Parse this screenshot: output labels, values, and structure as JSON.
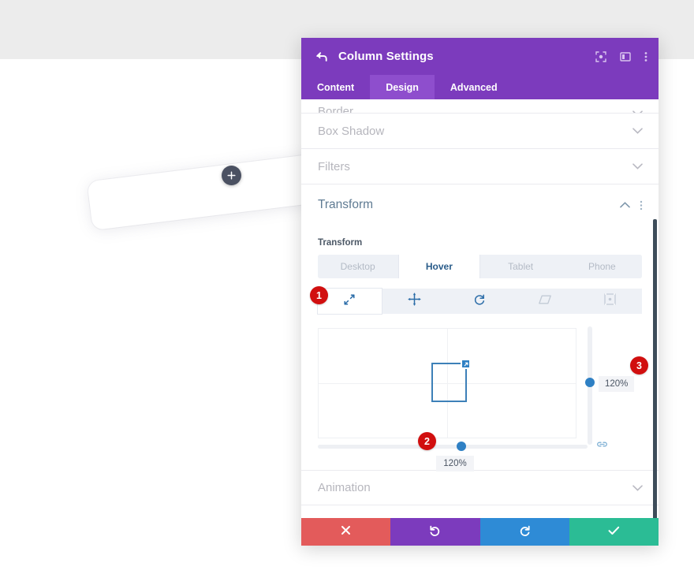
{
  "background": {
    "add_button_icon": "plus-icon",
    "row_label": ""
  },
  "modal": {
    "title": "Column Settings",
    "back_icon": "back-arrow-icon",
    "header_icons": [
      {
        "name": "focus-target-icon"
      },
      {
        "name": "layout-panel-icon"
      },
      {
        "name": "kebab-menu-icon"
      }
    ],
    "tabs": [
      {
        "label": "Content",
        "active": false
      },
      {
        "label": "Design",
        "active": true
      },
      {
        "label": "Advanced",
        "active": false
      }
    ],
    "sections": [
      {
        "label": "Border",
        "open": false,
        "clipped": true
      },
      {
        "label": "Box Shadow",
        "open": false,
        "clipped": false
      },
      {
        "label": "Filters",
        "open": false,
        "clipped": false
      },
      {
        "label": "Transform",
        "open": true,
        "clipped": false
      },
      {
        "label": "Animation",
        "open": false,
        "clipped": false
      }
    ],
    "transform": {
      "field_label": "Transform",
      "device_tabs": [
        {
          "label": "Desktop",
          "active": false
        },
        {
          "label": "Hover",
          "active": true
        },
        {
          "label": "Tablet",
          "active": false
        },
        {
          "label": "Phone",
          "active": false
        }
      ],
      "type_buttons": [
        {
          "name": "scale-icon",
          "active": true,
          "muted": false
        },
        {
          "name": "move-icon",
          "active": false,
          "muted": false
        },
        {
          "name": "rotate-icon",
          "active": false,
          "muted": false
        },
        {
          "name": "skew-icon",
          "active": false,
          "muted": true
        },
        {
          "name": "origin-icon",
          "active": false,
          "muted": true
        }
      ],
      "scale_vertical_value": "120%",
      "scale_horizontal_value": "120%",
      "link_icon": "link-chain-icon"
    },
    "badges": [
      {
        "id": 1,
        "label": "1"
      },
      {
        "id": 2,
        "label": "2"
      },
      {
        "id": 3,
        "label": "3"
      }
    ],
    "actions": [
      {
        "name": "cancel-button",
        "icon": "close-icon",
        "color": "#e35b5b"
      },
      {
        "name": "undo-button",
        "icon": "undo-icon",
        "color": "#7c3bbd"
      },
      {
        "name": "redo-button",
        "icon": "redo-icon",
        "color": "#2e8bd6"
      },
      {
        "name": "save-button",
        "icon": "check-icon",
        "color": "#2bbc95"
      }
    ]
  }
}
